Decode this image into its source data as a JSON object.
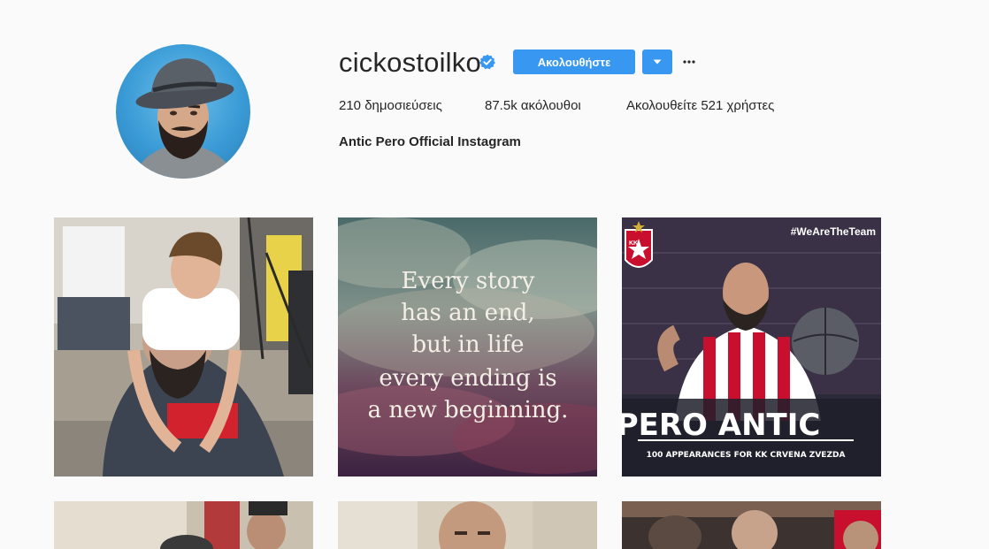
{
  "profile": {
    "username": "cickostoilko",
    "follow_label": "Ακολουθήστε",
    "posts_count": "210",
    "posts_label": "δημοσιεύσεις",
    "followers_count": "87.5k",
    "followers_label": "ακόλουθοι",
    "following_prefix": "Ακολουθείτε",
    "following_count": "521",
    "following_suffix": "χρήστες",
    "bio": "Antic Pero Official Instagram"
  },
  "posts": {
    "quote_lines": [
      "Every story",
      "has an end,",
      "but in life",
      "every ending is",
      "a new beginning."
    ],
    "hashtag": "#WeAreTheTeam",
    "club_badge": "KK",
    "poster_name": "PERO ANTIC",
    "poster_caption": "100 APPEARANCES FOR KK CRVENA ZVEZDA"
  },
  "colors": {
    "accent": "#3897f0",
    "verified": "#3897f0",
    "background": "#fafafa"
  },
  "icons": {
    "verified": "verified-badge-icon",
    "dropdown": "chevron-down-icon",
    "more": "ellipsis-icon"
  }
}
